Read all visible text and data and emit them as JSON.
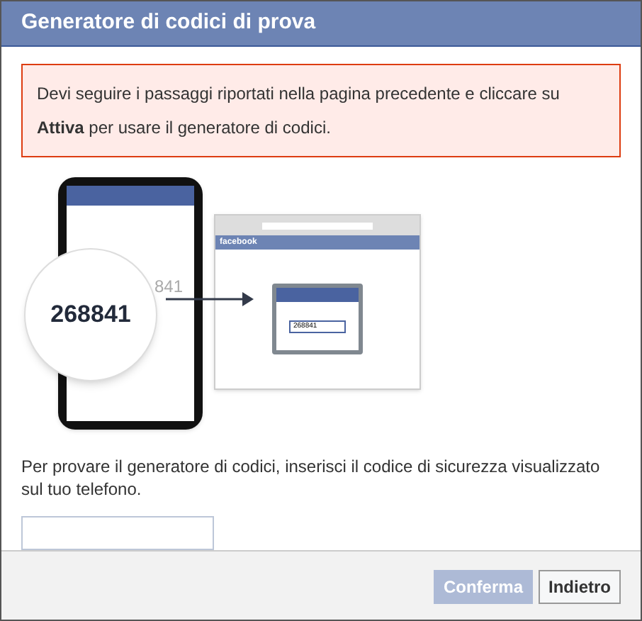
{
  "dialog": {
    "title": "Generatore di codici di prova"
  },
  "alert": {
    "text": "Devi seguire i passaggi riportati nella pagina precedente e cliccare su **Attiva** per usare il generatore di codici."
  },
  "illustration": {
    "phone_code_partial": "841",
    "magnified_code": "268841",
    "browser_brand": "facebook",
    "browser_field_value": "268841"
  },
  "instruction": "Per provare il generatore di codici, inserisci il codice di sicurezza visualizzato sul tuo telefono.",
  "buttons": [
    {
      "label": "Conferma",
      "disabled": true
    },
    {
      "label": "Indietro",
      "disabled": false
    }
  ]
}
